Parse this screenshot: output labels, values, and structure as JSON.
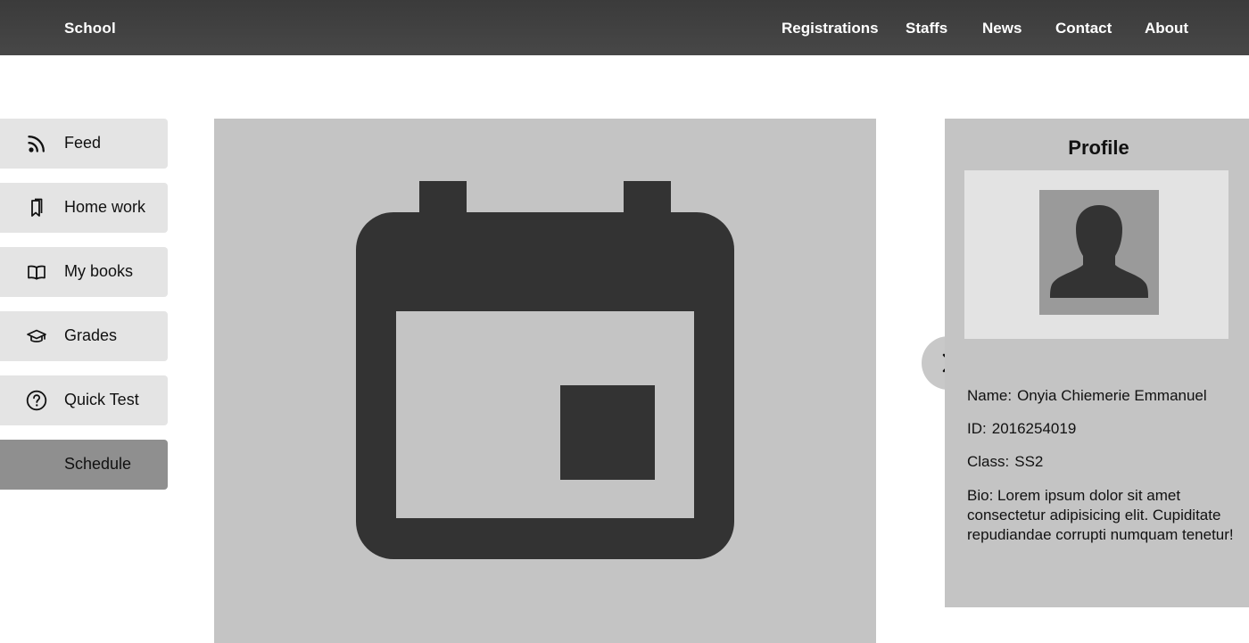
{
  "header": {
    "brand": "School",
    "nav": [
      {
        "label": "Registrations"
      },
      {
        "label": "Staffs"
      },
      {
        "label": "News"
      },
      {
        "label": "Contact"
      },
      {
        "label": "About"
      }
    ]
  },
  "sidebar": {
    "items": [
      {
        "label": "Feed",
        "icon": "rss-icon"
      },
      {
        "label": "Home work",
        "icon": "bookmark-icon"
      },
      {
        "label": "My books",
        "icon": "open-book-icon"
      },
      {
        "label": "Grades",
        "icon": "graduation-cap-icon"
      },
      {
        "label": "Quick Test",
        "icon": "question-circle-icon"
      },
      {
        "label": "Schedule",
        "icon": "",
        "active": true
      }
    ]
  },
  "main": {
    "icon": "calendar-event-icon"
  },
  "profile": {
    "title": "Profile",
    "name_label": "Name:",
    "name": "Onyia Chiemerie Emmanuel",
    "id_label": "ID:",
    "id": "2016254019",
    "class_label": "Class:",
    "class": "SS2",
    "bio_label": "Bio:",
    "bio": "Lorem ipsum dolor sit amet consectetur adipisicing elit. Cupiditate repudiandae corrupti numquam tenetur!",
    "avatar_icon": "person-silhouette-icon"
  },
  "toggle": {
    "icon": "chevron-right-icon"
  },
  "colors": {
    "topbar": "#444444",
    "sidebar_item": "#e4e4e4",
    "sidebar_active": "#8f8f8f",
    "panel": "#c4c4c4",
    "icon_dark": "#333333"
  }
}
